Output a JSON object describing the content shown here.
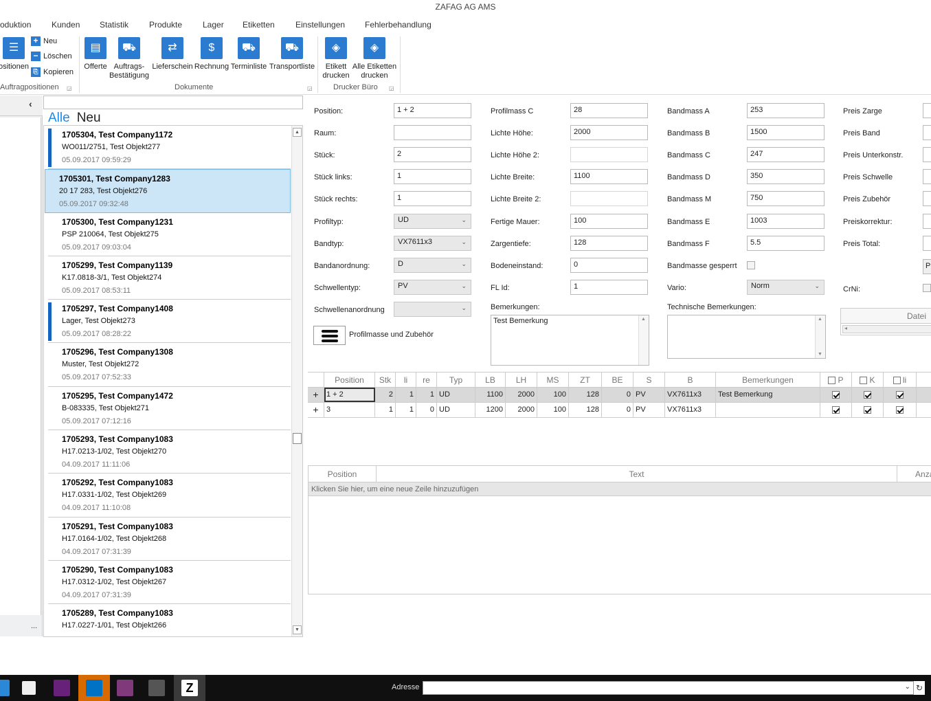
{
  "window": {
    "title": "ZAFAG AG AMS"
  },
  "menu": {
    "items": [
      "oduktion",
      "Kunden",
      "Statistik",
      "Produkte",
      "Lager",
      "Etiketten",
      "Einstellungen",
      "Fehlerbehandlung"
    ]
  },
  "ribbon": {
    "positions_label": "ositionen",
    "neu": "Neu",
    "loeschen": "Löschen",
    "kopieren": "Kopieren",
    "group_auftrag": "Auftragpositionen",
    "offerte": "Offerte",
    "auftrag": "Auftrags-Bestätigung",
    "lieferschein": "Lieferschein",
    "rechnung": "Rechnung",
    "terminliste": "Terminliste",
    "transportliste": "Transportliste",
    "group_dokumente": "Dokumente",
    "etikett": "Etikett drucken",
    "alle_etiketten": "Alle Etiketten drucken",
    "group_drucker": "Drucker Büro"
  },
  "list": {
    "collapse_glyph": "‹",
    "tab_all": "Alle",
    "tab_new": "Neu",
    "more": "...",
    "items": [
      {
        "title": "1705304, Test Company1172",
        "sub": "WO011/2751, Test Objekt277",
        "date": "05.09.2017 09:59:29",
        "flag": true,
        "selected": false
      },
      {
        "title": "1705301, Test Company1283",
        "sub": "20 17 283, Test Objekt276",
        "date": "05.09.2017 09:32:48",
        "flag": false,
        "selected": true
      },
      {
        "title": "1705300, Test Company1231",
        "sub": "PSP 210064, Test Objekt275",
        "date": "05.09.2017 09:03:04",
        "flag": false,
        "selected": false
      },
      {
        "title": "1705299, Test Company1139",
        "sub": "K17.0818-3/1, Test Objekt274",
        "date": "05.09.2017 08:53:11",
        "flag": false,
        "selected": false
      },
      {
        "title": "1705297, Test Company1408",
        "sub": "Lager, Test Objekt273",
        "date": "05.09.2017 08:28:22",
        "flag": true,
        "selected": false
      },
      {
        "title": "1705296, Test Company1308",
        "sub": "Muster, Test Objekt272",
        "date": "05.09.2017 07:52:33",
        "flag": false,
        "selected": false
      },
      {
        "title": "1705295, Test Company1472",
        "sub": "B-083335, Test Objekt271",
        "date": "05.09.2017 07:12:16",
        "flag": false,
        "selected": false
      },
      {
        "title": "1705293, Test Company1083",
        "sub": "H17.0213-1/02, Test Objekt270",
        "date": "04.09.2017 11:11:06",
        "flag": false,
        "selected": false
      },
      {
        "title": "1705292, Test Company1083",
        "sub": "H17.0331-1/02, Test Objekt269",
        "date": "04.09.2017 11:10:08",
        "flag": false,
        "selected": false
      },
      {
        "title": "1705291, Test Company1083",
        "sub": "H17.0164-1/02, Test Objekt268",
        "date": "04.09.2017 07:31:39",
        "flag": false,
        "selected": false
      },
      {
        "title": "1705290, Test Company1083",
        "sub": "H17.0312-1/02, Test Objekt267",
        "date": "04.09.2017 07:31:39",
        "flag": false,
        "selected": false
      },
      {
        "title": "1705289, Test Company1083",
        "sub": "H17.0227-1/01, Test Objekt266",
        "date": "",
        "flag": false,
        "selected": false
      }
    ]
  },
  "form": {
    "col1": {
      "position": {
        "label": "Position:",
        "value": "1 + 2"
      },
      "raum": {
        "label": "Raum:",
        "value": ""
      },
      "stueck": {
        "label": "Stück:",
        "value": "2"
      },
      "stueck_links": {
        "label": "Stück links:",
        "value": "1"
      },
      "stueck_rechts": {
        "label": "Stück rechts:",
        "value": "1"
      },
      "profiltyp": {
        "label": "Profiltyp:",
        "value": "UD"
      },
      "bandtyp": {
        "label": "Bandtyp:",
        "value": "VX7611x3"
      },
      "bandanordnung": {
        "label": "Bandanordnung:",
        "value": "D"
      },
      "schwellentyp": {
        "label": "Schwellentyp:",
        "value": "PV"
      },
      "schwellenanordnung": {
        "label": "Schwellenanordnung",
        "value": ""
      },
      "profilmasse_button": "Profilmasse und Zubehör"
    },
    "col2": {
      "profilmass_c": {
        "label": "Profilmass C",
        "value": "28"
      },
      "lichte_hoehe": {
        "label": "Lichte Höhe:",
        "value": "2000"
      },
      "lichte_hoehe2": {
        "label": "Lichte Höhe 2:",
        "value": ""
      },
      "lichte_breite": {
        "label": "Lichte Breite:",
        "value": "1100"
      },
      "lichte_breite2": {
        "label": "Lichte Breite 2:",
        "value": ""
      },
      "fertige_mauer": {
        "label": "Fertige Mauer:",
        "value": "100"
      },
      "zargentiefe": {
        "label": "Zargentiefe:",
        "value": "128"
      },
      "bodeneinstand": {
        "label": "Bodeneinstand:",
        "value": "0"
      },
      "fl_id": {
        "label": "FL Id:",
        "value": "1"
      },
      "bemerkungen": {
        "label": "Bemerkungen:",
        "value": "Test Bemerkung"
      }
    },
    "col3": {
      "bandmass_a": {
        "label": "Bandmass A",
        "value": "253"
      },
      "bandmass_b": {
        "label": "Bandmass B",
        "value": "1500"
      },
      "bandmass_c": {
        "label": "Bandmass C",
        "value": "247"
      },
      "bandmass_d": {
        "label": "Bandmass D",
        "value": "350"
      },
      "bandmass_m": {
        "label": "Bandmass M",
        "value": "750"
      },
      "bandmass_e": {
        "label": "Bandmass E",
        "value": "1003"
      },
      "bandmass_f": {
        "label": "Bandmass F",
        "value": "5.5"
      },
      "gesperrt": {
        "label": "Bandmasse gesperrt"
      },
      "vario": {
        "label": "Vario:",
        "value": "Norm"
      },
      "tech_bemerkungen": {
        "label": "Technische Bemerkungen:",
        "value": ""
      }
    },
    "col4": {
      "preis_zarge": "Preis Zarge",
      "preis_band": "Preis Band",
      "preis_unterkonstr": "Preis Unterkonstr.",
      "preis_schwelle": "Preis Schwelle",
      "preis_zubehoer": "Preis Zubehör",
      "preiskorrektur": "Preiskorrektur:",
      "preis_total": "Preis Total:",
      "pr_button": "Pr",
      "crni": "CrNi:",
      "datei_header": "Datei"
    }
  },
  "grid": {
    "headers": [
      "",
      "Position",
      "Stk",
      "li",
      "re",
      "Typ",
      "LB",
      "LH",
      "MS",
      "ZT",
      "BE",
      "S",
      "B",
      "Bemerkungen",
      "P",
      "K",
      "li"
    ],
    "rows": [
      {
        "expand": "+",
        "position": "1 + 2",
        "stk": "2",
        "li": "1",
        "re": "1",
        "typ": "UD",
        "lb": "1100",
        "lh": "2000",
        "ms": "100",
        "zt": "128",
        "be": "0",
        "s": "PV",
        "b": "VX7611x3",
        "bem": "Test Bemerkung",
        "p": true,
        "k": true,
        "li2": true
      },
      {
        "expand": "+",
        "position": "3",
        "stk": "1",
        "li": "1",
        "re": "0",
        "typ": "UD",
        "lb": "1200",
        "lh": "2000",
        "ms": "100",
        "zt": "128",
        "be": "0",
        "s": "PV",
        "b": "VX7611x3",
        "bem": "",
        "p": true,
        "k": true,
        "li2": true
      }
    ]
  },
  "grid2": {
    "headers": [
      "Position",
      "Text",
      "Anzal"
    ],
    "add_row": "Klicken Sie hier, um eine neue Zeile hinzuzufügen"
  },
  "taskbar": {
    "address_label": "Adresse"
  }
}
